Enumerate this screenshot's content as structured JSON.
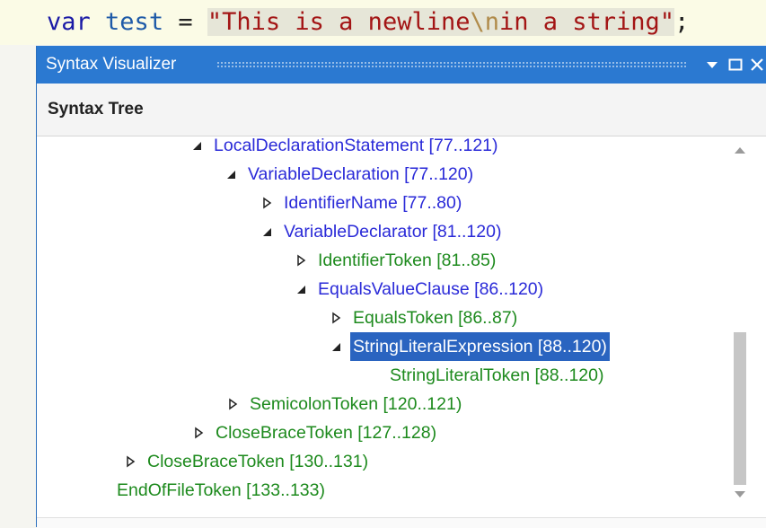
{
  "code": {
    "keyword": "var",
    "identifier": "test",
    "operator": "=",
    "string_start": "\"This is a newline",
    "escape": "\\n",
    "string_end": "in a string\"",
    "semicolon": ";"
  },
  "window": {
    "title": "Syntax Visualizer",
    "panel_title": "Syntax Tree"
  },
  "tree": {
    "nodes": [
      {
        "label": "LocalDeclarationStatement [77..121)"
      },
      {
        "label": "VariableDeclaration [77..120)"
      },
      {
        "label": "IdentifierName [77..80)"
      },
      {
        "label": "VariableDeclarator [81..120)"
      },
      {
        "label": "IdentifierToken [81..85)"
      },
      {
        "label": "EqualsValueClause [86..120)"
      },
      {
        "label": "EqualsToken [86..87)"
      },
      {
        "label": "StringLiteralExpression [88..120)"
      },
      {
        "label": "StringLiteralToken [88..120)"
      },
      {
        "label": "SemicolonToken [120..121)"
      },
      {
        "label": "CloseBraceToken [127..128)"
      },
      {
        "label": "CloseBraceToken [130..131)"
      },
      {
        "label": "EndOfFileToken [133..133)"
      }
    ]
  },
  "colors": {
    "titlebar": "#2b79d1",
    "node_blue": "#2a2ad8",
    "token_green": "#1d8a1d",
    "selection": "#2a64c0"
  }
}
